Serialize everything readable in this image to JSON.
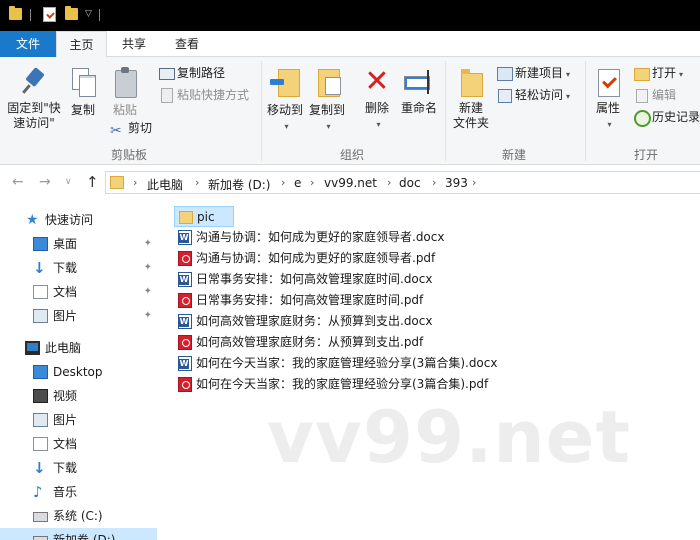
{
  "ribbon_tabs": {
    "file": "文件",
    "home": "主页",
    "share": "共享",
    "view": "查看"
  },
  "clipboard": {
    "pin_quick_access": "固定到\"快速访问\"",
    "copy": "复制",
    "paste": "粘贴",
    "copy_path": "复制路径",
    "paste_shortcut": "粘贴快捷方式",
    "cut": "剪切",
    "group_label": "剪贴板"
  },
  "organize": {
    "move_to": "移动到",
    "copy_to": "复制到",
    "delete": "删除",
    "rename": "重命名",
    "group_label": "组织"
  },
  "new": {
    "new_folder": "新建\n文件夹",
    "new_item": "新建项目",
    "easy_access": "轻松访问",
    "group_label": "新建"
  },
  "open": {
    "properties": "属性",
    "open": "打开",
    "edit": "编辑",
    "history": "历史记录",
    "group_label": "打开"
  },
  "breadcrumb": [
    "此电脑",
    "新加卷 (D:)",
    "e",
    "vv99.net",
    "doc",
    "393"
  ],
  "nav_pane": {
    "quick_access": "快速访问",
    "quick_items": [
      "桌面",
      "下载",
      "文档",
      "图片"
    ],
    "this_pc": "此电脑",
    "pc_items": [
      "Desktop",
      "视频",
      "图片",
      "文档",
      "下载",
      "音乐",
      "系统 (C:)",
      "新加卷 (D:)"
    ]
  },
  "files": [
    {
      "name": "pic",
      "type": "folder"
    },
    {
      "name": "沟通与协调：如何成为更好的家庭领导者.docx",
      "type": "docx"
    },
    {
      "name": "沟通与协调：如何成为更好的家庭领导者.pdf",
      "type": "pdf"
    },
    {
      "name": "日常事务安排：如何高效管理家庭时间.docx",
      "type": "docx"
    },
    {
      "name": "日常事务安排：如何高效管理家庭时间.pdf",
      "type": "pdf"
    },
    {
      "name": "如何高效管理家庭财务：从预算到支出.docx",
      "type": "docx"
    },
    {
      "name": "如何高效管理家庭财务：从预算到支出.pdf",
      "type": "pdf"
    },
    {
      "name": "如何在今天当家：我的家庭管理经验分享(3篇合集).docx",
      "type": "docx"
    },
    {
      "name": "如何在今天当家：我的家庭管理经验分享(3篇合集).pdf",
      "type": "pdf"
    }
  ],
  "watermark": "vv99.net"
}
